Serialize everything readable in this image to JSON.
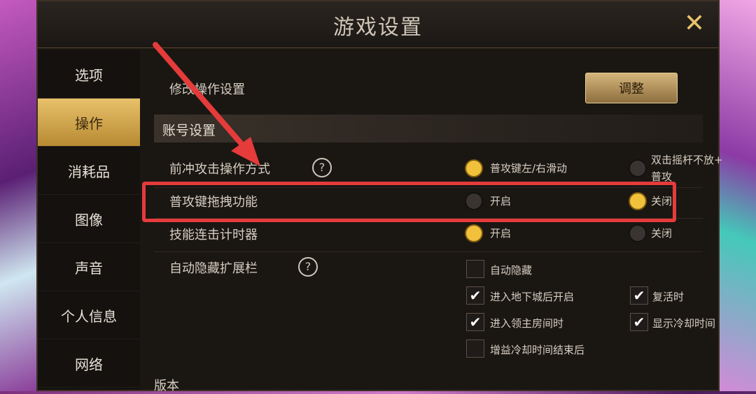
{
  "window": {
    "title": "游戏设置"
  },
  "sidebar": {
    "items": [
      {
        "label": "选项"
      },
      {
        "label": "操作",
        "active": true
      },
      {
        "label": "消耗品"
      },
      {
        "label": "图像"
      },
      {
        "label": "声音"
      },
      {
        "label": "个人信息"
      },
      {
        "label": "网络"
      }
    ]
  },
  "settings": {
    "modify_control": {
      "label": "修改操作设置",
      "button": "调整"
    },
    "section_title": "账号设置",
    "dash_attack": {
      "label": "前冲攻击操作方式",
      "opt1": "普攻键左/右滑动",
      "opt2_line1": "双击摇杆不放+",
      "opt2_line2": "普攻",
      "selected": 1
    },
    "drag_normal_attack": {
      "label": "普攻键拖拽功能",
      "opt_on": "开启",
      "opt_off": "关闭",
      "selected": "关闭"
    },
    "skill_combo_timer": {
      "label": "技能连击计时器",
      "opt_on": "开启",
      "opt_off": "关闭",
      "selected": "开启"
    },
    "auto_hide_bar": {
      "label": "自动隐藏扩展栏",
      "cb_auto_hide": "自动隐藏",
      "cb_dungeon": "进入地下城后开启",
      "cb_revive": "复活时",
      "cb_boss_room": "进入领主房间时",
      "cb_cooldown": "显示冷却时间",
      "cb_buff": "增益冷却时间结束后"
    },
    "version_label": "版本"
  },
  "icons": {
    "close": "close-x-icon",
    "help": "help-circle-icon"
  },
  "colors": {
    "accent": "#e8c16a",
    "highlight": "#e53b3b",
    "radio_on": "#f2c13b"
  }
}
